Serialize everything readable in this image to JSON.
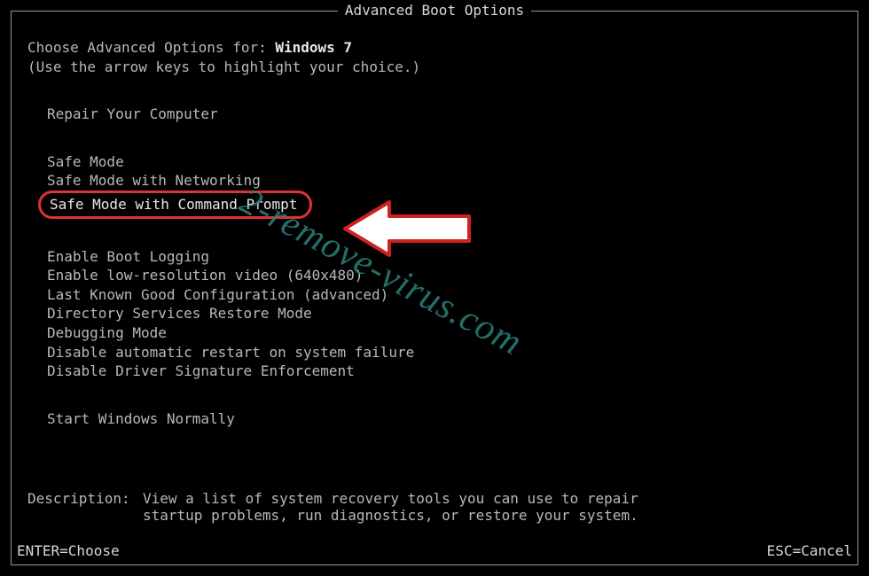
{
  "title": "Advanced Boot Options",
  "intro_prefix": "Choose Advanced Options for: ",
  "os_name": "Windows 7",
  "intro_hint": "(Use the arrow keys to highlight your choice.)",
  "groups": {
    "repair": [
      "Repair Your Computer"
    ],
    "safe": [
      "Safe Mode",
      "Safe Mode with Networking",
      "Safe Mode with Command Prompt"
    ],
    "other": [
      "Enable Boot Logging",
      "Enable low-resolution video (640x480)",
      "Last Known Good Configuration (advanced)",
      "Directory Services Restore Mode",
      "Debugging Mode",
      "Disable automatic restart on system failure",
      "Disable Driver Signature Enforcement"
    ],
    "normal": [
      "Start Windows Normally"
    ]
  },
  "selected_option": "Safe Mode with Command Prompt",
  "description_label": "Description:",
  "description_text": "View a list of system recovery tools you can use to repair startup problems, run diagnostics, or restore your system.",
  "footer_left": "ENTER=Choose",
  "footer_right": "ESC=Cancel",
  "watermark": "2-remove-virus.com",
  "colors": {
    "highlight_border": "#d33",
    "text": "#b8b8b8",
    "title": "#d8d8d8"
  }
}
